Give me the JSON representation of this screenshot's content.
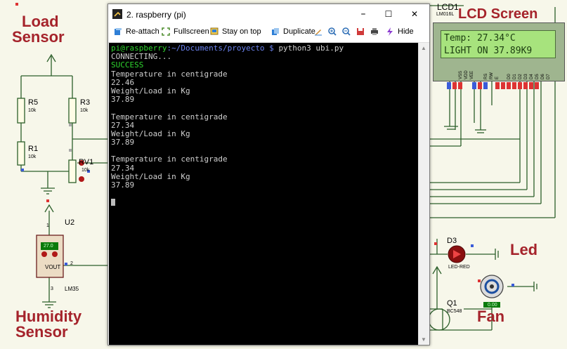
{
  "labels": {
    "load_sensor_1": "Load",
    "load_sensor_2": "Sensor",
    "humidity_sensor_1": "Humidity",
    "humidity_sensor_2": "Sensor",
    "lcd_screen": "LCD Screen",
    "lcd1": "LCD1",
    "lcd_model": "LM016L",
    "led": "Led",
    "fan": "Fan",
    "r5": "R5",
    "r5_val": "10k",
    "r3": "R3",
    "r3_val": "10k",
    "r1": "R1",
    "r1_val": "10k",
    "rv1": "RV1",
    "rv1_val": "10k",
    "u2": "U2",
    "lm35": "LM35",
    "vout": "VOUT",
    "lm35_display": "27.0",
    "pin1": "1",
    "pin2": "2",
    "pin3": "3",
    "d3": "D3",
    "led_red": "LED-RED",
    "q1": "Q1",
    "bc548": "BC548",
    "fan_display": "0.00",
    "lcd_line1": "Temp: 27.34°C",
    "lcd_line2": "LIGHT ON 37.89K9",
    "lcd_pins": [
      "VSS",
      "VDD",
      "VEE",
      "RS",
      "RW",
      "E",
      "D0",
      "D1",
      "D2",
      "D3",
      "D4",
      "D5",
      "D6",
      "D7"
    ]
  },
  "window": {
    "title": "2. raspberry (pi)",
    "minimize": "–",
    "maximize": "☐",
    "close": "✕"
  },
  "toolbar": {
    "reattach": "Re-attach",
    "fullscreen": "Fullscreen",
    "stay_on_top": "Stay on top",
    "duplicate": "Duplicate",
    "hide": "Hide"
  },
  "console": {
    "prompt_user": "pi@raspberry",
    "prompt_path": ":~/Documents/proyecto $ ",
    "prompt_cmd": "python3 ubi.py",
    "lines": [
      "CONNECTING...",
      "SUCCESS",
      "Temperature in centigrade",
      "22.46",
      "Weight/Load in Kg",
      "37.89",
      "",
      "Temperature in centigrade",
      "27.34",
      "Weight/Load in Kg",
      "37.89",
      "",
      "Temperature in centigrade",
      "27.34",
      "Weight/Load in Kg",
      "37.89"
    ]
  },
  "colors": {
    "label_red": "#a5232b",
    "wire": "#2c5f2a",
    "terminal_bg": "#000000",
    "prompt_green": "#2fd62f",
    "prompt_blue": "#6b83f0"
  }
}
